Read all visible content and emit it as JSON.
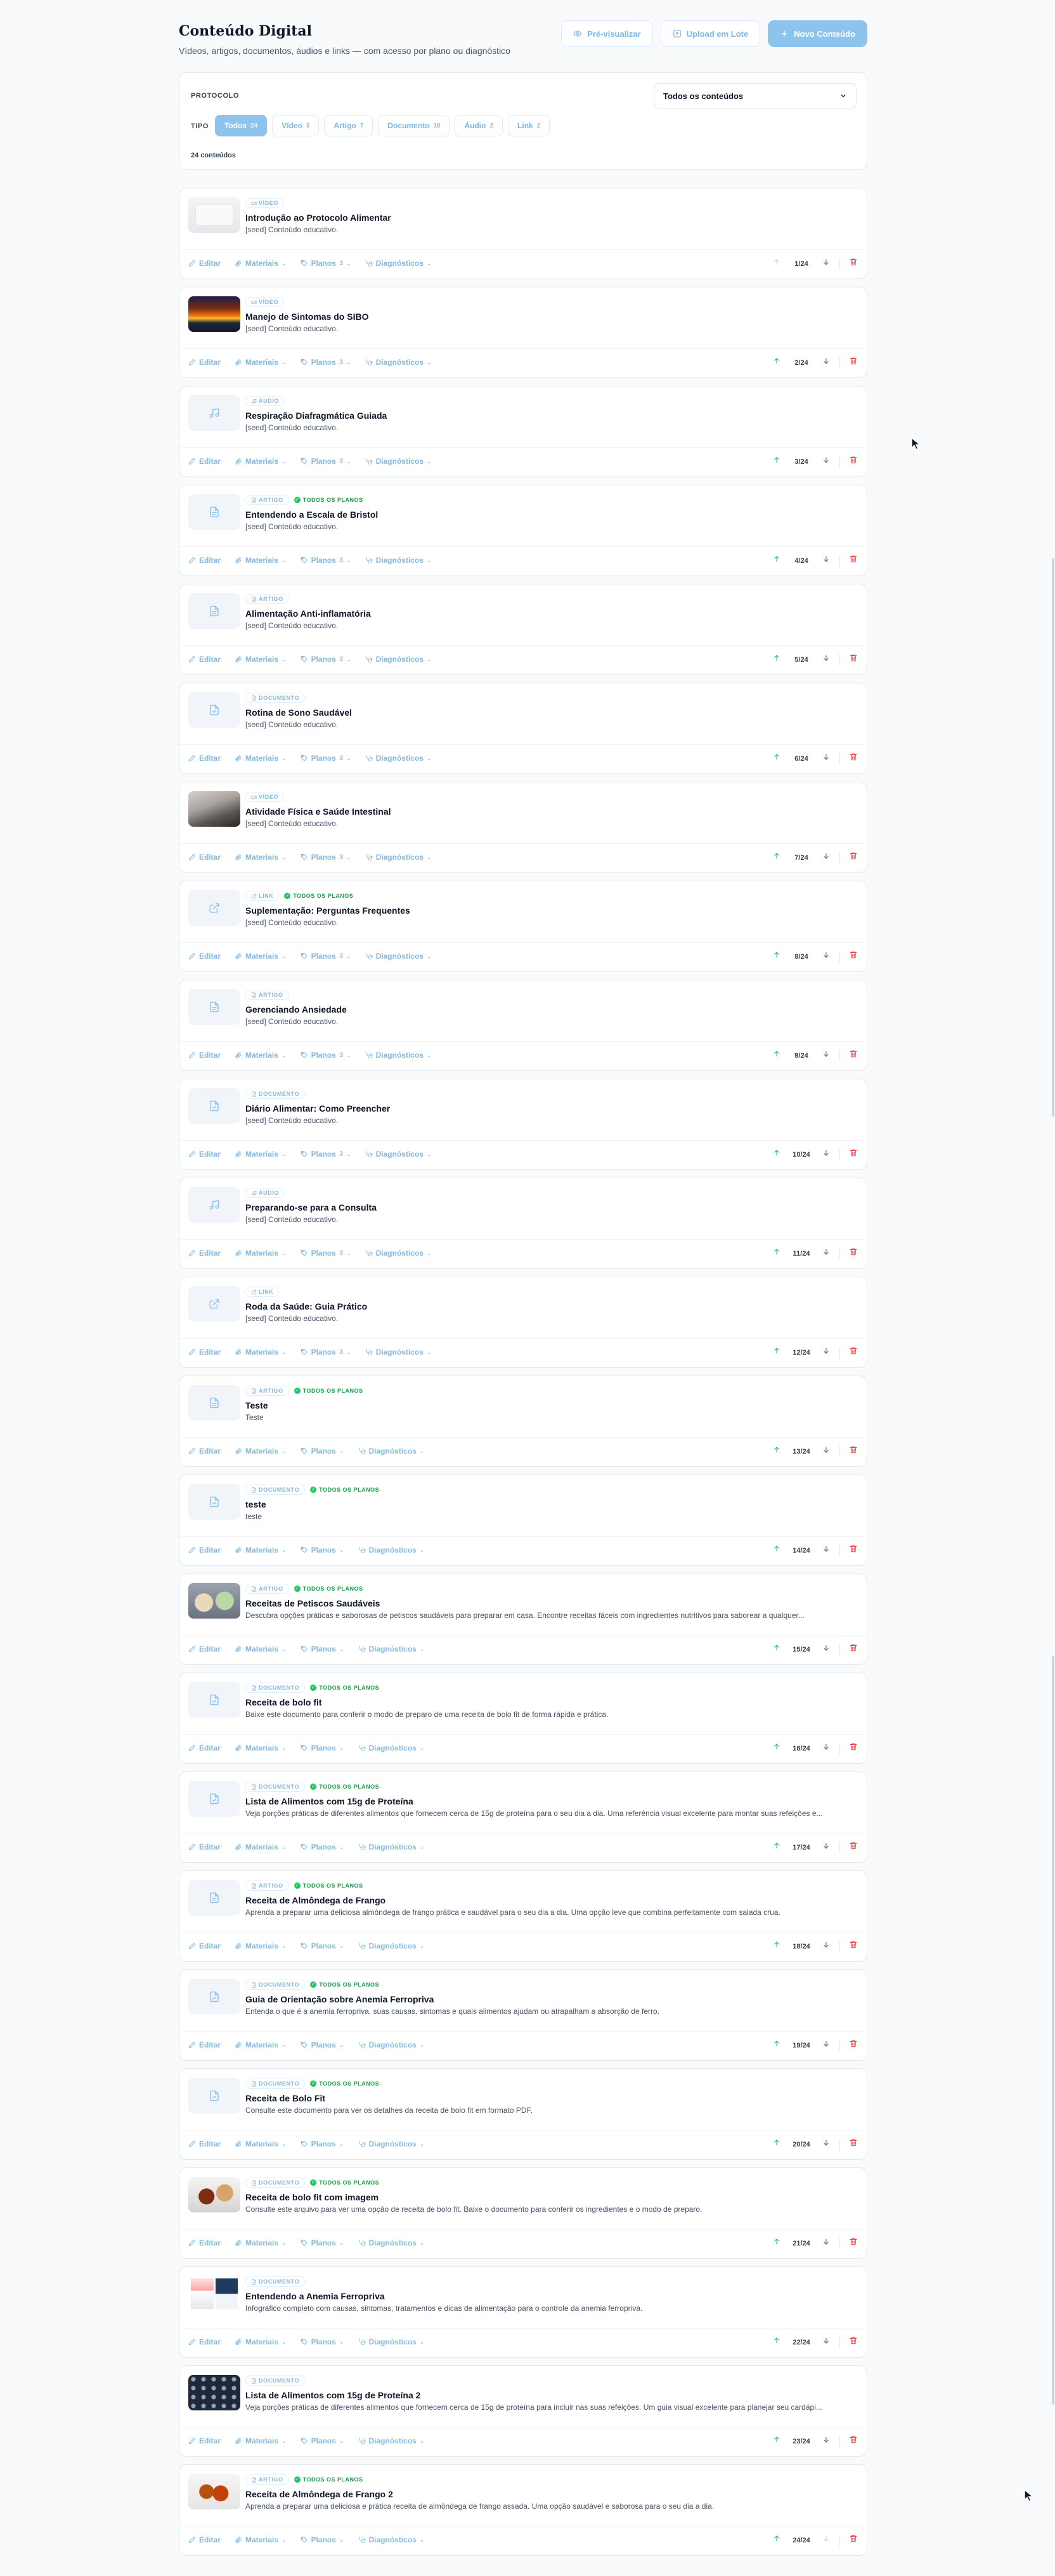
{
  "header": {
    "title": "Conteúdo Digital",
    "subtitle": "Vídeos, artigos, documentos, áudios e links — com acesso por plano ou diagnóstico",
    "preview_label": "Pré-visualizar",
    "batch_label": "Upload em Lote",
    "new_label": "Novo Conteúdo"
  },
  "filters": {
    "protocol_label": "PROTOCOLO",
    "protocol_value": "Todos os conteúdos",
    "type_label": "TIPO",
    "chips": [
      {
        "label": "Todos",
        "count": "24",
        "active": true
      },
      {
        "label": "Vídeo",
        "count": "3"
      },
      {
        "label": "Artigo",
        "count": "7"
      },
      {
        "label": "Documento",
        "count": "10"
      },
      {
        "label": "Áudio",
        "count": "2"
      },
      {
        "label": "Link",
        "count": "2"
      }
    ],
    "total": "24 conteúdos"
  },
  "actions": {
    "edit": "Editar",
    "materials": "Materiais",
    "plans": "Planos",
    "diagnostics": "Diagnósticos"
  },
  "all_plans_label": "TODOS OS PLANOS",
  "items": [
    {
      "type": "VÍDEO",
      "icon": "video-icon",
      "thumb": "video-white",
      "title": "Introdução ao Protocolo Alimentar",
      "desc": "[seed] Conteúdo educativo.",
      "plans": "3",
      "all": false,
      "pos": "1/24"
    },
    {
      "type": "VÍDEO",
      "icon": "video-icon",
      "thumb": "sunset",
      "title": "Manejo de Sintomas do SIBO",
      "desc": "[seed] Conteúdo educativo.",
      "plans": "3",
      "all": false,
      "pos": "2/24"
    },
    {
      "type": "ÁUDIO",
      "icon": "music-icon",
      "thumb": "music",
      "title": "Respiração Diafragmática Guiada",
      "desc": "[seed] Conteúdo educativo.",
      "plans": "3",
      "all": false,
      "pos": "3/24"
    },
    {
      "type": "ARTIGO",
      "icon": "article-icon",
      "thumb": "article",
      "title": "Entendendo a Escala de Bristol",
      "desc": "[seed] Conteúdo educativo.",
      "plans": "3",
      "all": true,
      "pos": "4/24"
    },
    {
      "type": "ARTIGO",
      "icon": "article-icon",
      "thumb": "article",
      "title": "Alimentação Anti-inflamatória",
      "desc": "[seed] Conteúdo educativo.",
      "plans": "3",
      "all": false,
      "pos": "5/24"
    },
    {
      "type": "DOCUMENTO",
      "icon": "document-icon",
      "thumb": "document",
      "title": "Rotina de Sono Saudável",
      "desc": "[seed] Conteúdo educativo.",
      "plans": "3",
      "all": false,
      "pos": "6/24"
    },
    {
      "type": "VÍDEO",
      "icon": "video-icon",
      "thumb": "landscape",
      "title": "Atividade Física e Saúde Intestinal",
      "desc": "[seed] Conteúdo educativo.",
      "plans": "3",
      "all": false,
      "pos": "7/24"
    },
    {
      "type": "LINK",
      "icon": "link-icon",
      "thumb": "link",
      "title": "Suplementação: Perguntas Frequentes",
      "desc": "[seed] Conteúdo educativo.",
      "plans": "3",
      "all": true,
      "pos": "8/24"
    },
    {
      "type": "ARTIGO",
      "icon": "article-icon",
      "thumb": "article",
      "title": "Gerenciando Ansiedade",
      "desc": "[seed] Conteúdo educativo.",
      "plans": "3",
      "all": false,
      "pos": "9/24"
    },
    {
      "type": "DOCUMENTO",
      "icon": "document-icon",
      "thumb": "document",
      "title": "Diário Alimentar: Como Preencher",
      "desc": "[seed] Conteúdo educativo.",
      "plans": "3",
      "all": false,
      "pos": "10/24"
    },
    {
      "type": "ÁUDIO",
      "icon": "music-icon",
      "thumb": "music",
      "title": "Preparando-se para a Consulta",
      "desc": "[seed] Conteúdo educativo.",
      "plans": "3",
      "all": false,
      "pos": "11/24"
    },
    {
      "type": "LINK",
      "icon": "link-icon",
      "thumb": "link",
      "title": "Roda da Saúde: Guia Prático",
      "desc": "[seed] Conteúdo educativo.",
      "plans": "3",
      "all": false,
      "pos": "12/24"
    },
    {
      "type": "ARTIGO",
      "icon": "article-icon",
      "thumb": "article",
      "title": "Teste",
      "desc": "Teste",
      "plans": "",
      "all": true,
      "pos": "13/24"
    },
    {
      "type": "DOCUMENTO",
      "icon": "document-icon",
      "thumb": "document",
      "title": "teste",
      "desc": "teste",
      "plans": "",
      "all": true,
      "pos": "14/24"
    },
    {
      "type": "ARTIGO",
      "icon": "article-icon",
      "thumb": "food",
      "title": "Receitas de Petiscos Saudáveis",
      "desc": "Descubra opções práticas e saborosas de petiscos saudáveis para preparar em casa. Encontre receitas fáceis com ingredientes nutritivos para saborear a qualquer...",
      "plans": "",
      "all": true,
      "pos": "15/24"
    },
    {
      "type": "DOCUMENTO",
      "icon": "document-icon",
      "thumb": "document",
      "title": "Receita de bolo fit",
      "desc": "Baixe este documento para conferir o modo de preparo de uma receita de bolo fit de forma rápida e prática.",
      "plans": "",
      "all": true,
      "pos": "16/24"
    },
    {
      "type": "DOCUMENTO",
      "icon": "document-icon",
      "thumb": "document",
      "title": "Lista de Alimentos com 15g de Proteína",
      "desc": "Veja porções práticas de diferentes alimentos que fornecem cerca de 15g de proteína para o seu dia a dia. Uma referência visual excelente para montar suas refeições e...",
      "plans": "",
      "all": true,
      "pos": "17/24"
    },
    {
      "type": "ARTIGO",
      "icon": "article-icon",
      "thumb": "article",
      "title": "Receita de Almôndega de Frango",
      "desc": "Aprenda a preparar uma deliciosa almôndega de frango prática e saudável para o seu dia a dia. Uma opção leve que combina perfeitamente com salada crua.",
      "plans": "",
      "all": true,
      "pos": "18/24"
    },
    {
      "type": "DOCUMENTO",
      "icon": "document-icon",
      "thumb": "document",
      "title": "Guia de Orientação sobre Anemia Ferropriva",
      "desc": "Entenda o que é a anemia ferropriva, suas causas, sintomas e quais alimentos ajudam ou atrapalham a absorção de ferro.",
      "plans": "",
      "all": true,
      "pos": "19/24"
    },
    {
      "type": "DOCUMENTO",
      "icon": "document-icon",
      "thumb": "document",
      "title": "Receita de Bolo Fit",
      "desc": "Consulte este documento para ver os detalhes da receita de bolo fit em formato PDF.",
      "plans": "",
      "all": true,
      "pos": "20/24"
    },
    {
      "type": "DOCUMENTO",
      "icon": "document-icon",
      "thumb": "cake",
      "title": "Receita de bolo fit com imagem",
      "desc": "Consulte este arquivo para ver uma opção de receita de bolo fit. Baixe o documento para conferir os ingredientes e o modo de preparo.",
      "plans": "",
      "all": true,
      "pos": "21/24"
    },
    {
      "type": "DOCUMENTO",
      "icon": "document-icon",
      "thumb": "infographic",
      "title": "Entendendo a Anemia Ferropriva",
      "desc": "Infográfico completo com causas, sintomas, tratamentos e dicas de alimentação para o controle da anemia ferropriva.",
      "plans": "",
      "all": false,
      "pos": "22/24"
    },
    {
      "type": "DOCUMENTO",
      "icon": "document-icon",
      "thumb": "dark-grid",
      "title": "Lista de Alimentos com 15g de Proteína 2",
      "desc": "Veja porções práticas de diferentes alimentos que fornecem cerca de 15g de proteína para incluir nas suas refeições. Um guia visual excelente para planejar seu cardápi...",
      "plans": "",
      "all": false,
      "pos": "23/24"
    },
    {
      "type": "ARTIGO",
      "icon": "article-icon",
      "thumb": "meatballs",
      "title": "Receita de Almôndega de Frango 2",
      "desc": "Aprenda a preparar uma deliciosa e prática receita de almôndega de frango assada. Uma opção saudável e saborosa para o seu dia a dia.",
      "plans": "",
      "all": true,
      "pos": "24/24"
    }
  ],
  "colors": {
    "accent": "#8cc4ee",
    "success": "#22c55e",
    "danger": "#ef4444"
  }
}
